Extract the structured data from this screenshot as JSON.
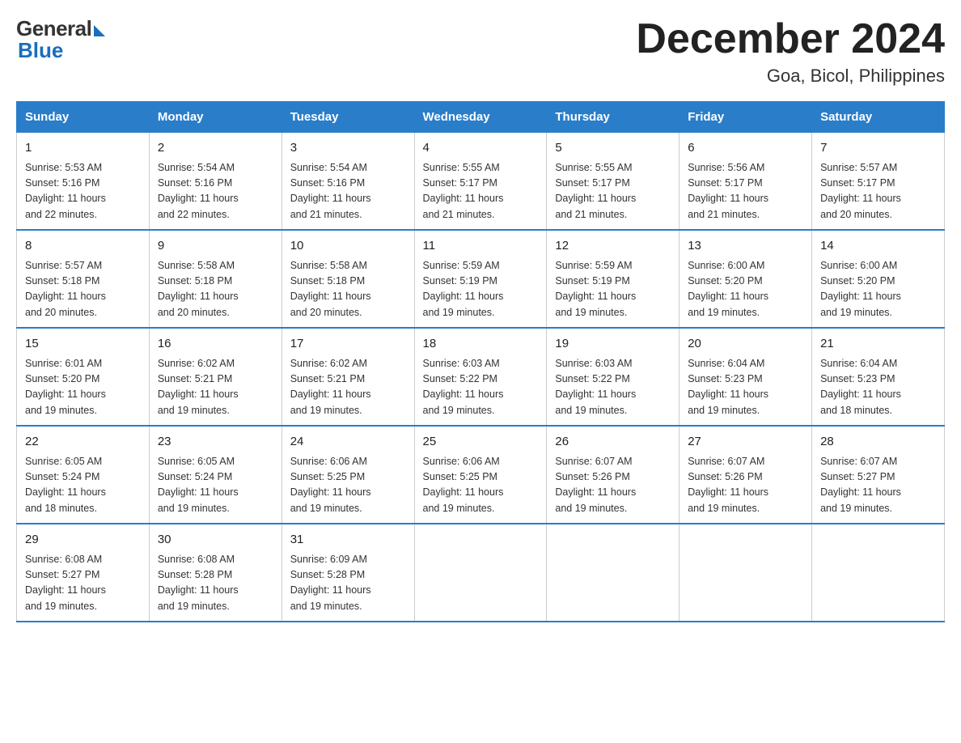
{
  "logo": {
    "general": "General",
    "blue": "Blue"
  },
  "title": "December 2024",
  "subtitle": "Goa, Bicol, Philippines",
  "days_of_week": [
    "Sunday",
    "Monday",
    "Tuesday",
    "Wednesday",
    "Thursday",
    "Friday",
    "Saturday"
  ],
  "weeks": [
    [
      {
        "day": "1",
        "sunrise": "5:53 AM",
        "sunset": "5:16 PM",
        "daylight": "11 hours and 22 minutes."
      },
      {
        "day": "2",
        "sunrise": "5:54 AM",
        "sunset": "5:16 PM",
        "daylight": "11 hours and 22 minutes."
      },
      {
        "day": "3",
        "sunrise": "5:54 AM",
        "sunset": "5:16 PM",
        "daylight": "11 hours and 21 minutes."
      },
      {
        "day": "4",
        "sunrise": "5:55 AM",
        "sunset": "5:17 PM",
        "daylight": "11 hours and 21 minutes."
      },
      {
        "day": "5",
        "sunrise": "5:55 AM",
        "sunset": "5:17 PM",
        "daylight": "11 hours and 21 minutes."
      },
      {
        "day": "6",
        "sunrise": "5:56 AM",
        "sunset": "5:17 PM",
        "daylight": "11 hours and 21 minutes."
      },
      {
        "day": "7",
        "sunrise": "5:57 AM",
        "sunset": "5:17 PM",
        "daylight": "11 hours and 20 minutes."
      }
    ],
    [
      {
        "day": "8",
        "sunrise": "5:57 AM",
        "sunset": "5:18 PM",
        "daylight": "11 hours and 20 minutes."
      },
      {
        "day": "9",
        "sunrise": "5:58 AM",
        "sunset": "5:18 PM",
        "daylight": "11 hours and 20 minutes."
      },
      {
        "day": "10",
        "sunrise": "5:58 AM",
        "sunset": "5:18 PM",
        "daylight": "11 hours and 20 minutes."
      },
      {
        "day": "11",
        "sunrise": "5:59 AM",
        "sunset": "5:19 PM",
        "daylight": "11 hours and 19 minutes."
      },
      {
        "day": "12",
        "sunrise": "5:59 AM",
        "sunset": "5:19 PM",
        "daylight": "11 hours and 19 minutes."
      },
      {
        "day": "13",
        "sunrise": "6:00 AM",
        "sunset": "5:20 PM",
        "daylight": "11 hours and 19 minutes."
      },
      {
        "day": "14",
        "sunrise": "6:00 AM",
        "sunset": "5:20 PM",
        "daylight": "11 hours and 19 minutes."
      }
    ],
    [
      {
        "day": "15",
        "sunrise": "6:01 AM",
        "sunset": "5:20 PM",
        "daylight": "11 hours and 19 minutes."
      },
      {
        "day": "16",
        "sunrise": "6:02 AM",
        "sunset": "5:21 PM",
        "daylight": "11 hours and 19 minutes."
      },
      {
        "day": "17",
        "sunrise": "6:02 AM",
        "sunset": "5:21 PM",
        "daylight": "11 hours and 19 minutes."
      },
      {
        "day": "18",
        "sunrise": "6:03 AM",
        "sunset": "5:22 PM",
        "daylight": "11 hours and 19 minutes."
      },
      {
        "day": "19",
        "sunrise": "6:03 AM",
        "sunset": "5:22 PM",
        "daylight": "11 hours and 19 minutes."
      },
      {
        "day": "20",
        "sunrise": "6:04 AM",
        "sunset": "5:23 PM",
        "daylight": "11 hours and 19 minutes."
      },
      {
        "day": "21",
        "sunrise": "6:04 AM",
        "sunset": "5:23 PM",
        "daylight": "11 hours and 18 minutes."
      }
    ],
    [
      {
        "day": "22",
        "sunrise": "6:05 AM",
        "sunset": "5:24 PM",
        "daylight": "11 hours and 18 minutes."
      },
      {
        "day": "23",
        "sunrise": "6:05 AM",
        "sunset": "5:24 PM",
        "daylight": "11 hours and 19 minutes."
      },
      {
        "day": "24",
        "sunrise": "6:06 AM",
        "sunset": "5:25 PM",
        "daylight": "11 hours and 19 minutes."
      },
      {
        "day": "25",
        "sunrise": "6:06 AM",
        "sunset": "5:25 PM",
        "daylight": "11 hours and 19 minutes."
      },
      {
        "day": "26",
        "sunrise": "6:07 AM",
        "sunset": "5:26 PM",
        "daylight": "11 hours and 19 minutes."
      },
      {
        "day": "27",
        "sunrise": "6:07 AM",
        "sunset": "5:26 PM",
        "daylight": "11 hours and 19 minutes."
      },
      {
        "day": "28",
        "sunrise": "6:07 AM",
        "sunset": "5:27 PM",
        "daylight": "11 hours and 19 minutes."
      }
    ],
    [
      {
        "day": "29",
        "sunrise": "6:08 AM",
        "sunset": "5:27 PM",
        "daylight": "11 hours and 19 minutes."
      },
      {
        "day": "30",
        "sunrise": "6:08 AM",
        "sunset": "5:28 PM",
        "daylight": "11 hours and 19 minutes."
      },
      {
        "day": "31",
        "sunrise": "6:09 AM",
        "sunset": "5:28 PM",
        "daylight": "11 hours and 19 minutes."
      },
      null,
      null,
      null,
      null
    ]
  ],
  "labels": {
    "sunrise": "Sunrise:",
    "sunset": "Sunset:",
    "daylight": "Daylight:"
  }
}
